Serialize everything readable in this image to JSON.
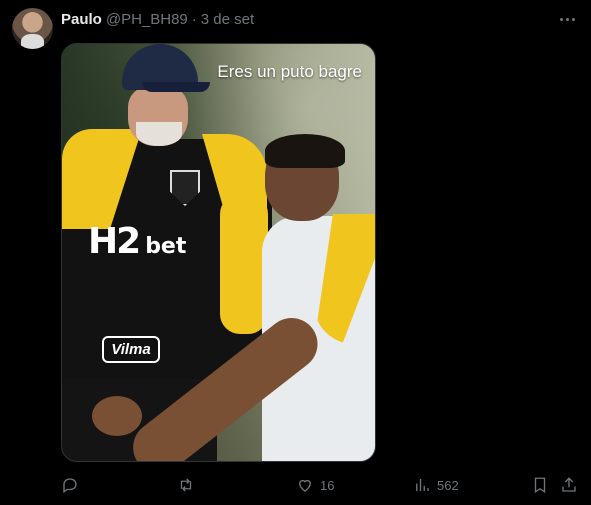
{
  "post": {
    "author_name": "Paulo",
    "handle": "@PH_BH89",
    "separator": "·",
    "timestamp": "3 de set"
  },
  "media": {
    "caption": "Eres un puto bagre",
    "jersey_sponsor": "H2",
    "jersey_sponsor_suffix": "bet",
    "shorts_sponsor": "Vilma"
  },
  "actions": {
    "reply_count": "",
    "retweet_count": "",
    "like_count": "16",
    "view_count": "562"
  },
  "icons": {
    "reply": "reply-icon",
    "retweet": "retweet-icon",
    "like": "heart-icon",
    "views": "views-icon",
    "bookmark": "bookmark-icon",
    "share": "share-icon",
    "more": "more-icon"
  },
  "colors": {
    "background": "#000000",
    "text_primary": "#e7e9ea",
    "text_secondary": "#71767b",
    "jersey_yellow": "#f0c51d"
  }
}
